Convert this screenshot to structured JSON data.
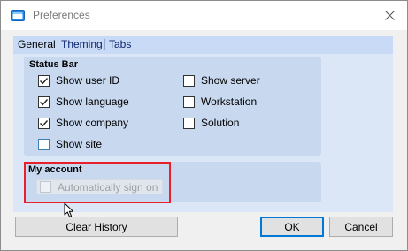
{
  "window": {
    "title": "Preferences",
    "app_icon": "window-icon",
    "close_icon": "close-icon"
  },
  "tabs": [
    {
      "label": "General",
      "active": true
    },
    {
      "label": "Theming",
      "active": false
    },
    {
      "label": "Tabs",
      "active": false
    }
  ],
  "status_bar": {
    "title": "Status Bar",
    "left": [
      {
        "label": "Show user ID",
        "checked": true
      },
      {
        "label": "Show language",
        "checked": true
      },
      {
        "label": "Show company",
        "checked": true
      },
      {
        "label": "Show site",
        "checked": false
      }
    ],
    "right": [
      {
        "label": "Show server",
        "checked": false
      },
      {
        "label": "Workstation",
        "checked": false
      },
      {
        "label": "Solution",
        "checked": false
      }
    ]
  },
  "my_account": {
    "title": "My account",
    "auto_sign_on": {
      "label": "Automatically sign on",
      "checked": false,
      "disabled": true
    }
  },
  "buttons": {
    "clear_history": "Clear History",
    "ok": "OK",
    "cancel": "Cancel"
  },
  "colors": {
    "highlight_box": "#e8202a",
    "tab_strip": "#c9daf7",
    "panel": "#dbe6f7",
    "group": "#c8d8ef",
    "default_button_border": "#0078d7"
  }
}
